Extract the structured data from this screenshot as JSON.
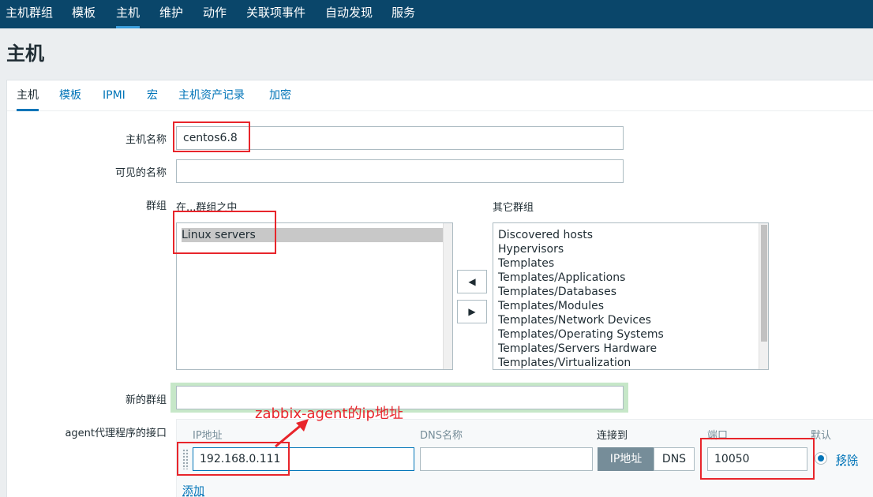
{
  "topnav": {
    "items": [
      {
        "label": "主机群组"
      },
      {
        "label": "模板"
      },
      {
        "label": "主机",
        "active": true
      },
      {
        "label": "维护"
      },
      {
        "label": "动作"
      },
      {
        "label": "关联项事件"
      },
      {
        "label": "自动发现"
      },
      {
        "label": "服务"
      }
    ]
  },
  "page": {
    "title": "主机"
  },
  "tabs": [
    {
      "label": "主机",
      "active": true
    },
    {
      "label": "模板"
    },
    {
      "label": "IPMI"
    },
    {
      "label": "宏"
    },
    {
      "label": "主机资产记录"
    },
    {
      "label": "加密"
    }
  ],
  "form": {
    "host_name_label": "主机名称",
    "host_name_value": "centos6.8",
    "visible_name_label": "可见的名称",
    "visible_name_value": "",
    "groups_label": "群组",
    "in_groups_label": "在...群组之中",
    "in_groups": [
      "Linux servers"
    ],
    "other_groups_label": "其它群组",
    "other_groups": [
      "Discovered hosts",
      "Hypervisors",
      "Templates",
      "Templates/Applications",
      "Templates/Databases",
      "Templates/Modules",
      "Templates/Network Devices",
      "Templates/Operating Systems",
      "Templates/Servers Hardware",
      "Templates/Virtualization"
    ],
    "move_left_glyph": "◀",
    "move_right_glyph": "▶",
    "new_group_label": "新的群组",
    "new_group_value": "",
    "agent_interface_label": "agent代理程序的接口",
    "interface": {
      "col_ip": "IP地址",
      "col_dns": "DNS名称",
      "col_connect": "连接到",
      "col_port": "端口",
      "col_default": "默认",
      "ip_value": "192.168.0.111",
      "dns_value": "",
      "connect_ip": "IP地址",
      "connect_dns": "DNS",
      "port_value": "10050",
      "remove_label": "移除",
      "add_label": "添加"
    }
  },
  "annotation": {
    "text": "zabbix-agent的ip地址",
    "color": "#e8252b"
  }
}
